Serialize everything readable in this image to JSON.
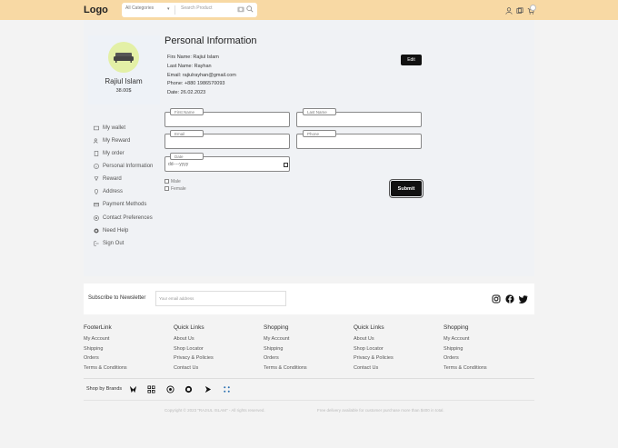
{
  "header": {
    "logo": "Logo",
    "category_label": "All Categories",
    "search_placeholder": "Search Product"
  },
  "profile": {
    "name": "Rajiul Islam",
    "balance": "38.00$"
  },
  "sidebar": {
    "items": [
      {
        "label": "My wallet",
        "icon": "wallet-icon"
      },
      {
        "label": "My Reward",
        "icon": "reward-user-icon"
      },
      {
        "label": "My order",
        "icon": "order-icon"
      },
      {
        "label": "Personal Information",
        "icon": "info-icon"
      },
      {
        "label": "Reward",
        "icon": "trophy-icon"
      },
      {
        "label": "Address",
        "icon": "location-icon"
      },
      {
        "label": "Payment Methods",
        "icon": "payment-icon"
      },
      {
        "label": "Contact Preferences",
        "icon": "contact-icon"
      },
      {
        "label": "Need Help",
        "icon": "help-icon"
      },
      {
        "label": "Sign Out",
        "icon": "signout-icon"
      }
    ]
  },
  "personal": {
    "title": "Personal Information",
    "first_name": "Firs Name: Rajiul Islam",
    "last_name": "Last Name: Rayhan",
    "email": "Email: rajiulrayhan@gmail.com",
    "phone": "Phone: +880 1986570093",
    "date": "Date: 26.02.2023",
    "edit_label": "Edit"
  },
  "form": {
    "first_name_label": "First Name",
    "last_name_label": "Last Name",
    "email_label": "Email",
    "phone_label": "Phone",
    "date_label": "Date",
    "date_placeholder": "dd----yyyy",
    "male_label": "Male",
    "female_label": "Female",
    "submit_label": "Submit"
  },
  "newsletter": {
    "label": "Subscribe to Newsletter",
    "placeholder": "Your email address"
  },
  "footer": {
    "columns": [
      {
        "heading": "FooterLink",
        "links": [
          "My Account",
          "Shipping",
          "Orders",
          "Terms & Conditions"
        ]
      },
      {
        "heading": "Quick Links",
        "links": [
          "About Us",
          "Shop Locator",
          "Privacy & Policies",
          "Contact Us"
        ]
      },
      {
        "heading": "Shopping",
        "links": [
          "My Account",
          "Shipping",
          "Orders",
          "Terms & Conditions"
        ]
      },
      {
        "heading": "Quick Links",
        "links": [
          "About Us",
          "Shop Locator",
          "Privacy & Policies",
          "Contact Us"
        ]
      },
      {
        "heading": "Shopping",
        "links": [
          "My Account",
          "Shipping",
          "Orders",
          "Terms & Conditions"
        ]
      }
    ],
    "brands_label": "Shop by Brands",
    "copyright": "Copyright © 2023 \"RAJIUL ISLAM\" - All rights reserved.",
    "shipping_note": "Free delivery available for customer purchase more than $400 in total."
  },
  "colors": {
    "header_bg": "#f8d9a4",
    "avatar_bg": "#e3f0a6",
    "button_bg": "#111111"
  }
}
